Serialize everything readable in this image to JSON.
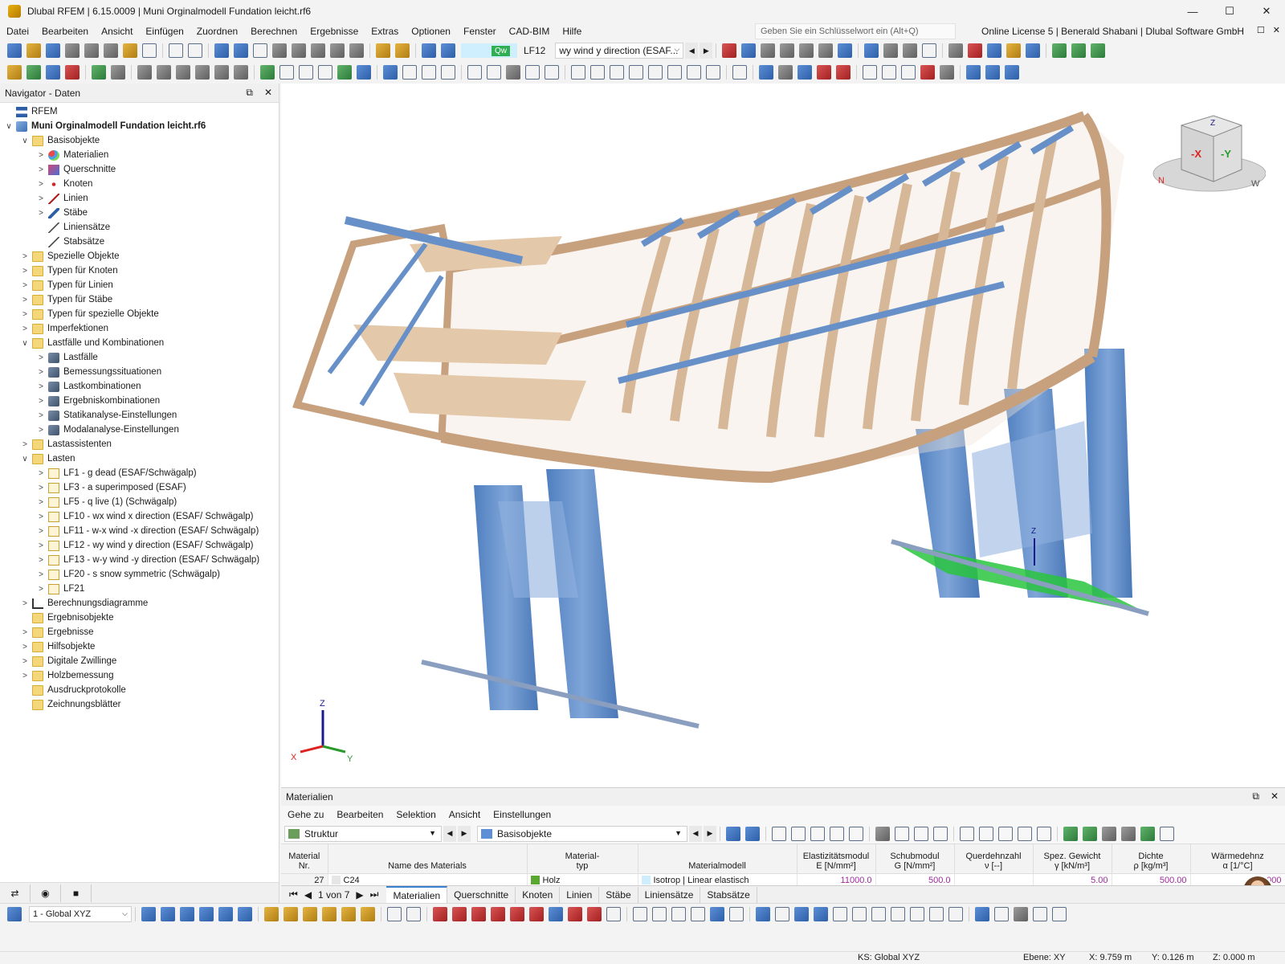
{
  "window": {
    "title": "Dlubal RFEM | 6.15.0009 | Muni Orginalmodell Fundation leicht.rf6",
    "controls": [
      "—",
      "☐",
      "✕"
    ]
  },
  "menu": [
    "Datei",
    "Bearbeiten",
    "Ansicht",
    "Einfügen",
    "Zuordnen",
    "Berechnen",
    "Ergebnisse",
    "Extras",
    "Optionen",
    "Fenster",
    "CAD-BIM",
    "Hilfe"
  ],
  "search": {
    "placeholder": "Geben Sie ein Schlüsselwort ein (Alt+Q)"
  },
  "license": "Online License 5 | Benerald Shabani | Dlubal Software GmbH",
  "loadcase": {
    "badge": "Qw",
    "id": "LF12",
    "name": "wy wind y direction (ESAF..."
  },
  "navigator": {
    "title": "Navigator - Daten",
    "items": [
      {
        "label": "RFEM",
        "level": 0,
        "toggle": "",
        "icon": "flag"
      },
      {
        "label": "Muni Orginalmodell Fundation leicht.rf6",
        "level": 0,
        "toggle": "∨",
        "icon": "model",
        "bold": true
      },
      {
        "label": "Basisobjekte",
        "level": 1,
        "toggle": "∨",
        "icon": "folder"
      },
      {
        "label": "Materialien",
        "level": 2,
        "toggle": ">",
        "icon": "mat"
      },
      {
        "label": "Querschnitte",
        "level": 2,
        "toggle": ">",
        "icon": "cs"
      },
      {
        "label": "Knoten",
        "level": 2,
        "toggle": ">",
        "icon": "node"
      },
      {
        "label": "Linien",
        "level": 2,
        "toggle": ">",
        "icon": "line"
      },
      {
        "label": "Stäbe",
        "level": 2,
        "toggle": ">",
        "icon": "member"
      },
      {
        "label": "Liniensätze",
        "level": 2,
        "toggle": "",
        "icon": "set"
      },
      {
        "label": "Stabsätze",
        "level": 2,
        "toggle": "",
        "icon": "set"
      },
      {
        "label": "Spezielle Objekte",
        "level": 1,
        "toggle": ">",
        "icon": "folder"
      },
      {
        "label": "Typen für Knoten",
        "level": 1,
        "toggle": ">",
        "icon": "folder"
      },
      {
        "label": "Typen für Linien",
        "level": 1,
        "toggle": ">",
        "icon": "folder"
      },
      {
        "label": "Typen für Stäbe",
        "level": 1,
        "toggle": ">",
        "icon": "folder"
      },
      {
        "label": "Typen für spezielle Objekte",
        "level": 1,
        "toggle": ">",
        "icon": "folder"
      },
      {
        "label": "Imperfektionen",
        "level": 1,
        "toggle": ">",
        "icon": "folder"
      },
      {
        "label": "Lastfälle und Kombinationen",
        "level": 1,
        "toggle": "∨",
        "icon": "folder"
      },
      {
        "label": "Lastfälle",
        "level": 2,
        "toggle": ">",
        "icon": "gen"
      },
      {
        "label": "Bemessungssituationen",
        "level": 2,
        "toggle": ">",
        "icon": "gen"
      },
      {
        "label": "Lastkombinationen",
        "level": 2,
        "toggle": ">",
        "icon": "gen"
      },
      {
        "label": "Ergebniskombinationen",
        "level": 2,
        "toggle": ">",
        "icon": "gen"
      },
      {
        "label": "Statikanalyse-Einstellungen",
        "level": 2,
        "toggle": ">",
        "icon": "gen"
      },
      {
        "label": "Modalanalyse-Einstellungen",
        "level": 2,
        "toggle": ">",
        "icon": "gen"
      },
      {
        "label": "Lastassistenten",
        "level": 1,
        "toggle": ">",
        "icon": "folder"
      },
      {
        "label": "Lasten",
        "level": 1,
        "toggle": "∨",
        "icon": "folder"
      },
      {
        "label": "LF1 - g dead (ESAF/Schwägalp)",
        "level": 2,
        "toggle": ">",
        "icon": "lcfolder"
      },
      {
        "label": "LF3 - a superimposed (ESAF)",
        "level": 2,
        "toggle": ">",
        "icon": "lcfolder"
      },
      {
        "label": "LF5 - q live (1) (Schwägalp)",
        "level": 2,
        "toggle": ">",
        "icon": "lcfolder"
      },
      {
        "label": "LF10 - wx wind x direction (ESAF/ Schwägalp)",
        "level": 2,
        "toggle": ">",
        "icon": "lcfolder"
      },
      {
        "label": "LF11 - w-x wind -x direction (ESAF/ Schwägalp)",
        "level": 2,
        "toggle": ">",
        "icon": "lcfolder"
      },
      {
        "label": "LF12 - wy wind y direction (ESAF/ Schwägalp)",
        "level": 2,
        "toggle": ">",
        "icon": "lcfolder"
      },
      {
        "label": "LF13 - w-y wind -y direction (ESAF/ Schwägalp)",
        "level": 2,
        "toggle": ">",
        "icon": "lcfolder"
      },
      {
        "label": "LF20 - s snow symmetric (Schwägalp)",
        "level": 2,
        "toggle": ">",
        "icon": "lcfolder"
      },
      {
        "label": "LF21",
        "level": 2,
        "toggle": ">",
        "icon": "lcfolder"
      },
      {
        "label": "Berechnungsdiagramme",
        "level": 1,
        "toggle": ">",
        "icon": "diag"
      },
      {
        "label": "Ergebnisobjekte",
        "level": 1,
        "toggle": "",
        "icon": "folder"
      },
      {
        "label": "Ergebnisse",
        "level": 1,
        "toggle": ">",
        "icon": "folder"
      },
      {
        "label": "Hilfsobjekte",
        "level": 1,
        "toggle": ">",
        "icon": "folder"
      },
      {
        "label": "Digitale Zwillinge",
        "level": 1,
        "toggle": ">",
        "icon": "folder"
      },
      {
        "label": "Holzbemessung",
        "level": 1,
        "toggle": ">",
        "icon": "folder"
      },
      {
        "label": "Ausdruckprotokolle",
        "level": 1,
        "toggle": "",
        "icon": "folder"
      },
      {
        "label": "Zeichnungsblätter",
        "level": 1,
        "toggle": "",
        "icon": "folder"
      }
    ]
  },
  "viewcube": {
    "x": "-X",
    "y": "-Y",
    "z": "Z",
    "n": "N",
    "w": "W"
  },
  "axes": {
    "x": "X",
    "y": "Y",
    "z": "Z"
  },
  "panel": {
    "title": "Materialien",
    "menu": [
      "Gehe zu",
      "Bearbeiten",
      "Selektion",
      "Ansicht",
      "Einstellungen"
    ],
    "filter1": "Struktur",
    "filter2": "Basisobjekte",
    "columns": [
      {
        "h1": "Material",
        "h2": "Nr."
      },
      {
        "h1": "",
        "h2": "Name des Materials"
      },
      {
        "h1": "Material-",
        "h2": "typ"
      },
      {
        "h1": "",
        "h2": "Materialmodell"
      },
      {
        "h1": "Elastizitätsmodul",
        "h2": "E [N/mm²]"
      },
      {
        "h1": "Schubmodul",
        "h2": "G [N/mm²]"
      },
      {
        "h1": "Querdehnzahl",
        "h2": "ν [--]"
      },
      {
        "h1": "Spez. Gewicht",
        "h2": "γ [kN/m³]"
      },
      {
        "h1": "Dichte",
        "h2": "ρ [kg/m³]"
      },
      {
        "h1": "Wärmedehnz",
        "h2": "α [1/°C]"
      }
    ],
    "row": {
      "nr": "27",
      "name": "C24",
      "type": "Holz",
      "model": "Isotrop | Linear elastisch",
      "e": "11000.0",
      "g": "500.0",
      "nu": "",
      "gamma": "5.00",
      "rho": "500.00",
      "alpha": ".000"
    },
    "pager": "1 von 7",
    "tabs": [
      "Materialien",
      "Querschnitte",
      "Knoten",
      "Linien",
      "Stäbe",
      "Liniensätze",
      "Stabsätze"
    ]
  },
  "bottom": {
    "coord_system": "1 - Global XYZ"
  },
  "status": {
    "ks": "KS: Global XYZ",
    "plane": "Ebene: XY",
    "x": "X: 9.759 m",
    "y": "Y: 0.126 m",
    "z": "Z: 0.000 m"
  }
}
